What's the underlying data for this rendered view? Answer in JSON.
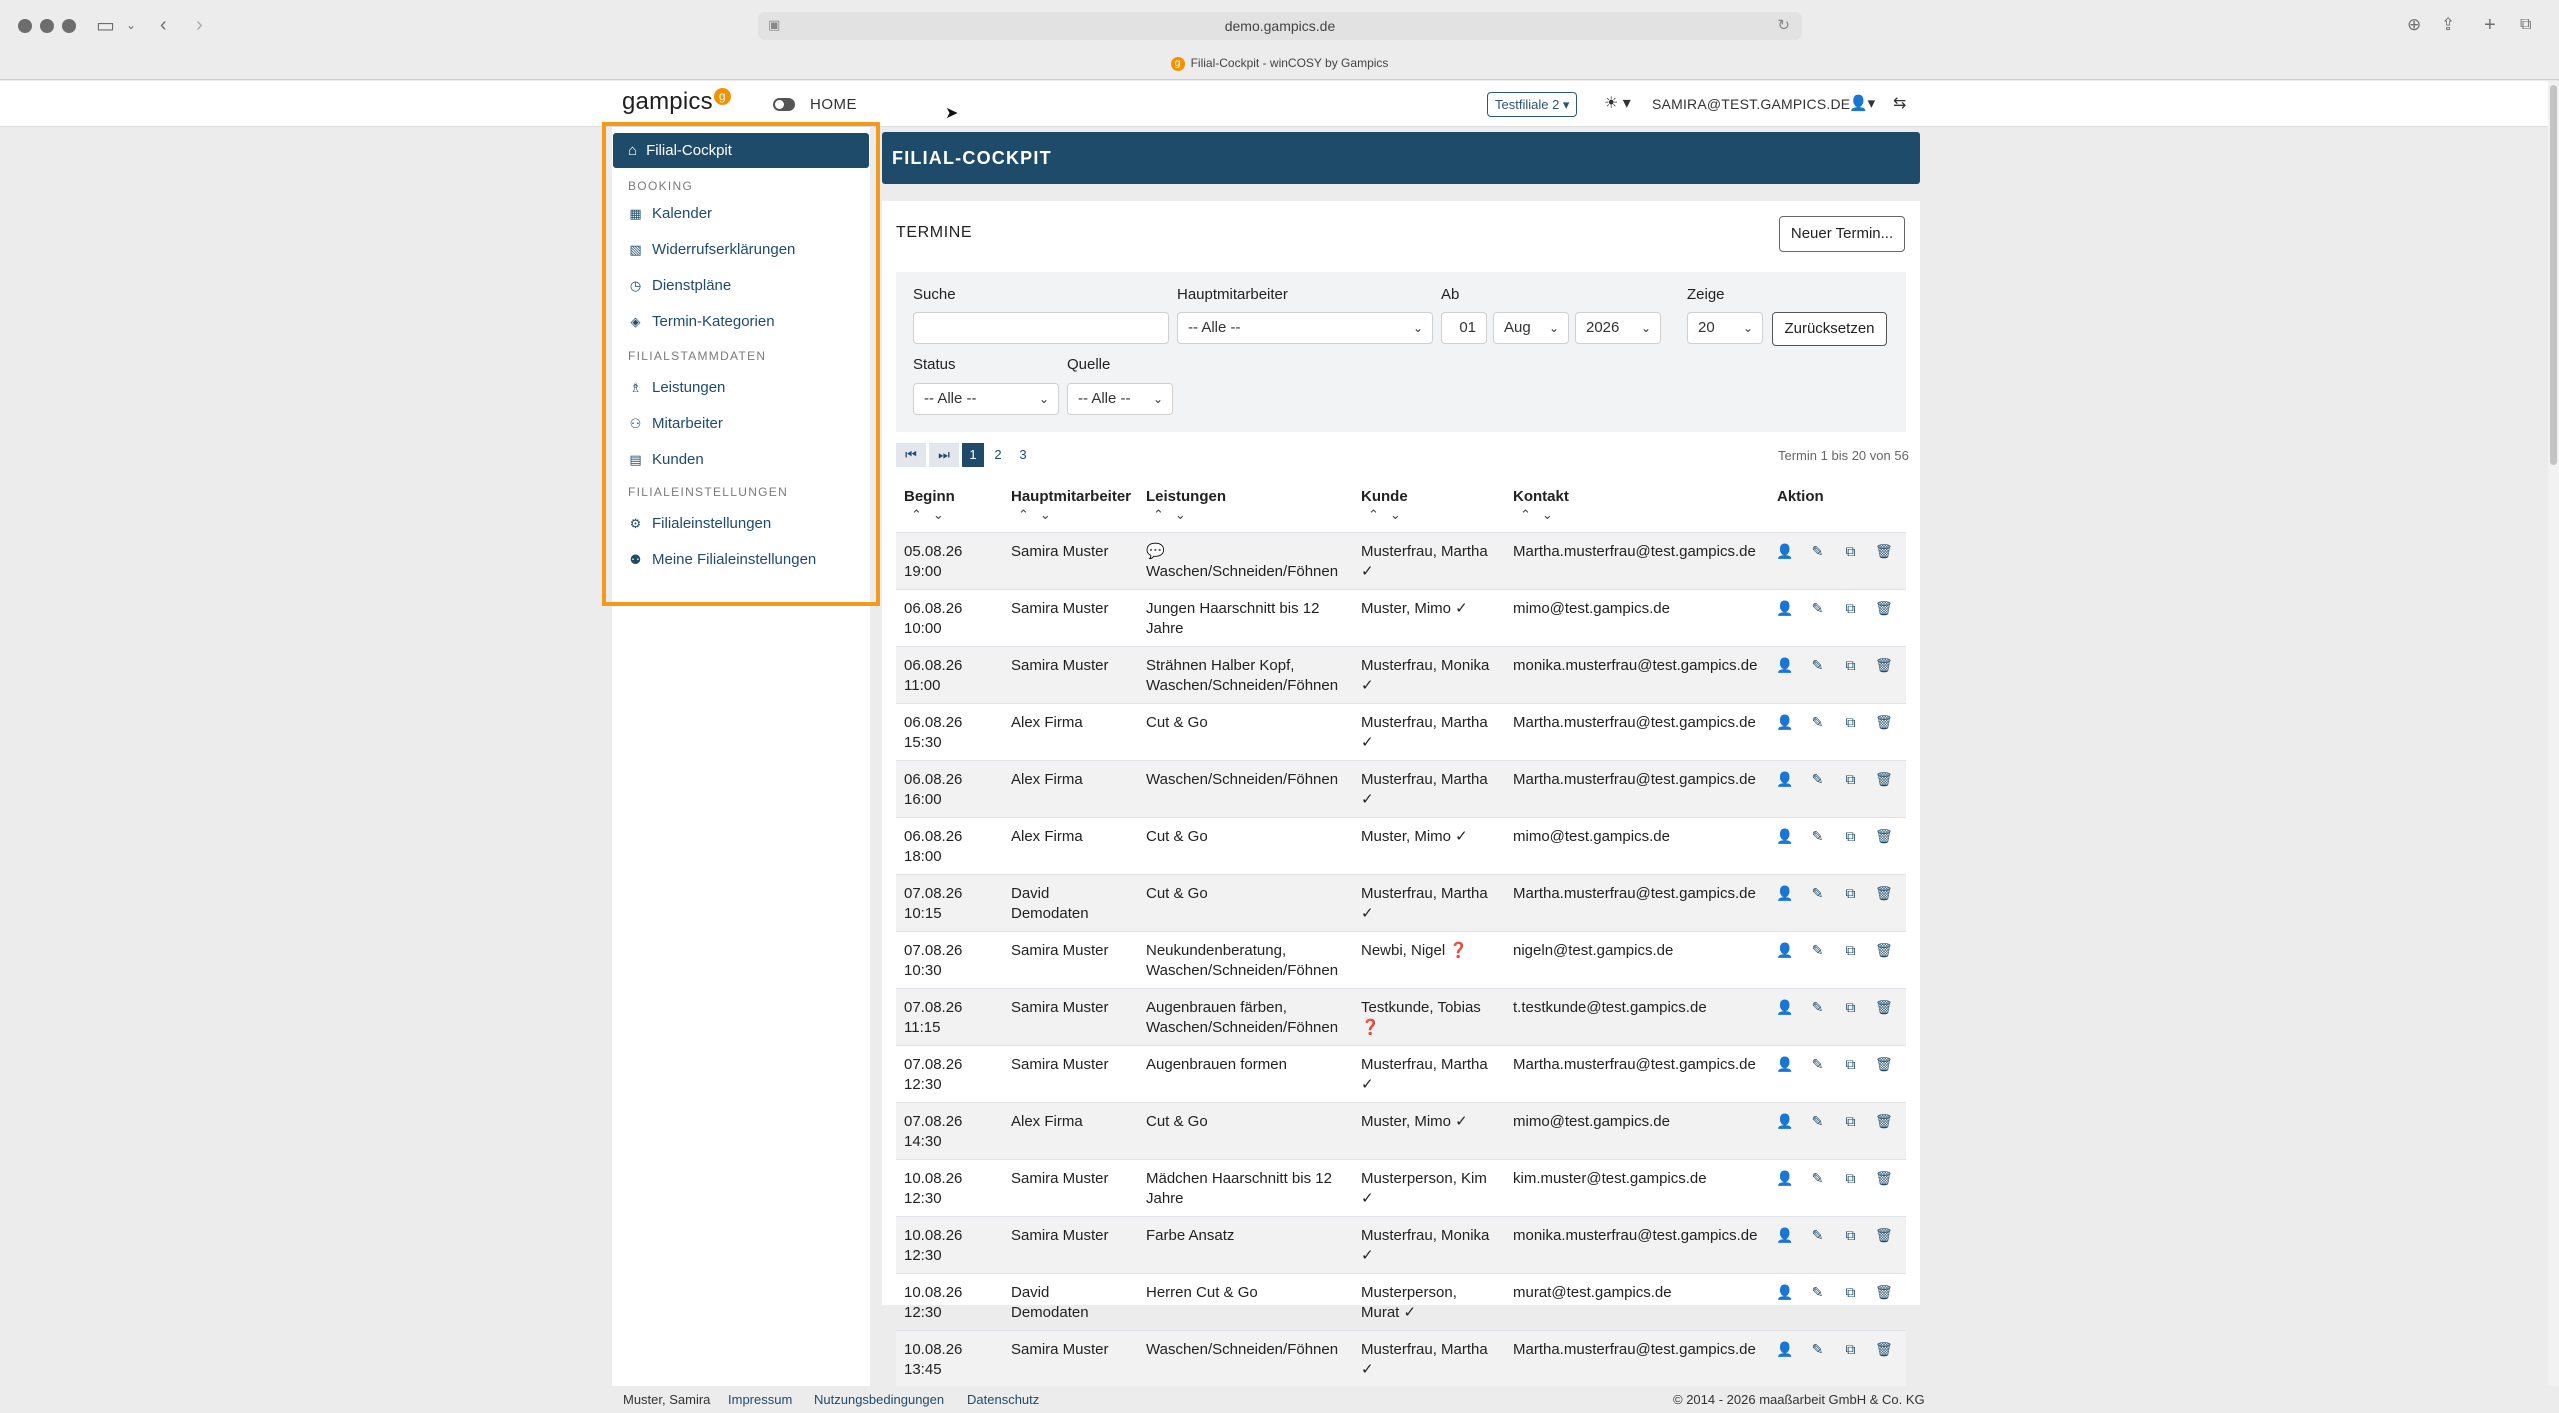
{
  "browser": {
    "url": "demo.gampics.de",
    "tab_title": "Filial-Cockpit - winCOSY by Gampics",
    "icons": [
      "sidebar-icon",
      "back-icon",
      "forward-icon",
      "download-icon",
      "share-icon",
      "new-tab-icon",
      "tabs-icon"
    ]
  },
  "header": {
    "logo": "gampics",
    "logo_badge": "g",
    "home": "HOME",
    "branch": "Testfiliale 2",
    "theme_icon": "☀",
    "user": "SAMIRA@TEST.GAMPICS.DE"
  },
  "sidebar": {
    "active": "Filial-Cockpit",
    "sections": [
      {
        "title": "BOOKING",
        "items": [
          "Kalender",
          "Widerrufserklärungen",
          "Dienstpläne",
          "Termin-Kategorien"
        ]
      },
      {
        "title": "FILIALSTAMMDATEN",
        "items": [
          "Leistungen",
          "Mitarbeiter",
          "Kunden"
        ]
      },
      {
        "title": "FILIALEINSTELLUNGEN",
        "items": [
          "Filialeinstellungen",
          "Meine Filialeinstellungen"
        ]
      }
    ]
  },
  "main": {
    "page_title": "FILIAL-COCKPIT",
    "card_title": "TERMINE",
    "new_button": "Neuer Termin...",
    "filters": {
      "search_label": "Suche",
      "search_value": "",
      "employee_label": "Hauptmitarbeiter",
      "employee_value": "-- Alle --",
      "from_label": "Ab",
      "from_day": "01",
      "from_month": "Aug",
      "from_year": "2026",
      "show_label": "Zeige",
      "show_value": "20",
      "reset_button": "Zurücksetzen",
      "status_label": "Status",
      "status_value": "-- Alle --",
      "source_label": "Quelle",
      "source_value": "-- Alle --"
    },
    "pagination": {
      "first": "⏮",
      "last": "⏭",
      "pages": [
        "1",
        "2",
        "3"
      ],
      "current": "1"
    },
    "count_text": "Termin 1 bis 20 von 56",
    "columns": [
      "Beginn",
      "Hauptmitarbeiter",
      "Leistungen",
      "Kunde",
      "Kontakt",
      "Aktion"
    ],
    "rows": [
      {
        "date": "05.08.26",
        "time": "19:00",
        "emp1": "Samira Muster",
        "emp2": "",
        "svc1": "💬",
        "svc2": "Waschen/Schneiden/Föhnen",
        "cust1": "Musterfrau, Martha",
        "cust2": "✓",
        "contact": "Martha.musterfrau@test.gampics.de"
      },
      {
        "date": "06.08.26",
        "time": "10:00",
        "emp1": "Samira Muster",
        "emp2": "",
        "svc1": "Jungen Haarschnitt bis 12",
        "svc2": "Jahre",
        "cust1": "Muster, Mimo ✓",
        "cust2": "",
        "contact": "mimo@test.gampics.de"
      },
      {
        "date": "06.08.26",
        "time": "11:00",
        "emp1": "Samira Muster",
        "emp2": "",
        "svc1": "Strähnen Halber Kopf,",
        "svc2": "Waschen/Schneiden/Föhnen",
        "cust1": "Musterfrau, Monika",
        "cust2": "✓",
        "contact": "monika.musterfrau@test.gampics.de"
      },
      {
        "date": "06.08.26",
        "time": "15:30",
        "emp1": "Alex Firma",
        "emp2": "",
        "svc1": "Cut & Go",
        "svc2": "",
        "cust1": "Musterfrau, Martha",
        "cust2": "✓",
        "contact": "Martha.musterfrau@test.gampics.de"
      },
      {
        "date": "06.08.26",
        "time": "16:00",
        "emp1": "Alex Firma",
        "emp2": "",
        "svc1": "Waschen/Schneiden/Föhnen",
        "svc2": "",
        "cust1": "Musterfrau, Martha",
        "cust2": "✓",
        "contact": "Martha.musterfrau@test.gampics.de"
      },
      {
        "date": "06.08.26",
        "time": "18:00",
        "emp1": "Alex Firma",
        "emp2": "",
        "svc1": "Cut & Go",
        "svc2": "",
        "cust1": "Muster, Mimo ✓",
        "cust2": "",
        "contact": "mimo@test.gampics.de"
      },
      {
        "date": "07.08.26",
        "time": "10:15",
        "emp1": "David",
        "emp2": "Demodaten",
        "svc1": "Cut & Go",
        "svc2": "",
        "cust1": "Musterfrau, Martha",
        "cust2": "✓",
        "contact": "Martha.musterfrau@test.gampics.de"
      },
      {
        "date": "07.08.26",
        "time": "10:30",
        "emp1": "Samira Muster",
        "emp2": "",
        "svc1": "Neukundenberatung,",
        "svc2": "Waschen/Schneiden/Föhnen",
        "cust1": "Newbi, Nigel ❓",
        "cust2": "",
        "contact": "nigeln@test.gampics.de"
      },
      {
        "date": "07.08.26",
        "time": "11:15",
        "emp1": "Samira Muster",
        "emp2": "",
        "svc1": "Augenbrauen färben,",
        "svc2": "Waschen/Schneiden/Föhnen",
        "cust1": "Testkunde, Tobias",
        "cust2": "❓",
        "contact": "t.testkunde@test.gampics.de"
      },
      {
        "date": "07.08.26",
        "time": "12:30",
        "emp1": "Samira Muster",
        "emp2": "",
        "svc1": "Augenbrauen formen",
        "svc2": "",
        "cust1": "Musterfrau, Martha",
        "cust2": "✓",
        "contact": "Martha.musterfrau@test.gampics.de"
      },
      {
        "date": "07.08.26",
        "time": "14:30",
        "emp1": "Alex Firma",
        "emp2": "",
        "svc1": "Cut & Go",
        "svc2": "",
        "cust1": "Muster, Mimo ✓",
        "cust2": "",
        "contact": "mimo@test.gampics.de"
      },
      {
        "date": "10.08.26",
        "time": "12:30",
        "emp1": "Samira Muster",
        "emp2": "",
        "svc1": "Mädchen Haarschnitt bis 12",
        "svc2": "Jahre",
        "cust1": "Musterperson, Kim",
        "cust2": "✓",
        "contact": "kim.muster@test.gampics.de"
      },
      {
        "date": "10.08.26",
        "time": "12:30",
        "emp1": "Samira Muster",
        "emp2": "",
        "svc1": "Farbe Ansatz",
        "svc2": "",
        "cust1": "Musterfrau, Monika",
        "cust2": "✓",
        "contact": "monika.musterfrau@test.gampics.de"
      },
      {
        "date": "10.08.26",
        "time": "12:30",
        "emp1": "David",
        "emp2": "Demodaten",
        "svc1": "Herren Cut & Go",
        "svc2": "",
        "cust1": "Musterperson,",
        "cust2": "Murat ✓",
        "contact": "murat@test.gampics.de"
      },
      {
        "date": "10.08.26",
        "time": "13:45",
        "emp1": "Samira Muster",
        "emp2": "",
        "svc1": "Waschen/Schneiden/Föhnen",
        "svc2": "",
        "cust1": "Musterfrau, Martha",
        "cust2": "✓",
        "contact": "Martha.musterfrau@test.gampics.de"
      }
    ]
  },
  "footer": {
    "user": "Muster, Samira",
    "links": [
      "Impressum",
      "Nutzungsbedingungen",
      "Datenschutz"
    ],
    "copyright": "© 2014 - 2026 maaßarbeit GmbH & Co. KG"
  },
  "colors": {
    "primary": "#1f4b6a",
    "brand": "#f39200",
    "highlight": "#f39a1d"
  }
}
